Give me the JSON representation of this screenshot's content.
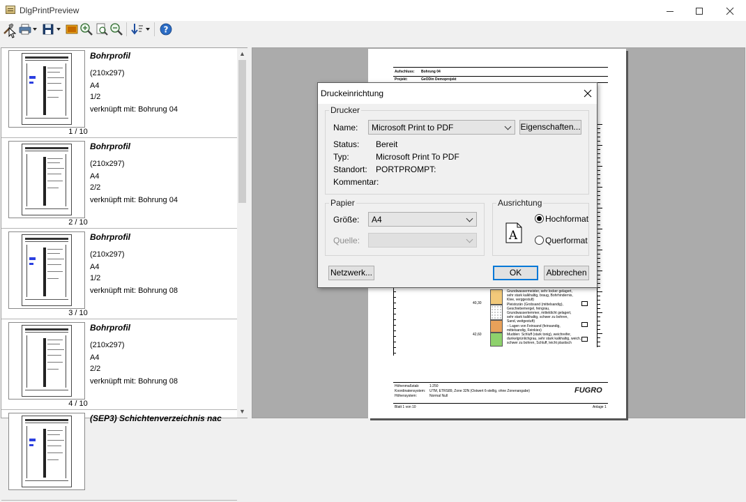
{
  "window": {
    "title": "DlgPrintPreview"
  },
  "toolbar": {
    "icons": [
      "tools-icon",
      "printer-icon",
      "save-icon",
      "image-icon",
      "zoom-in-icon",
      "zoom-page-icon",
      "zoom-out-icon",
      "sort-icon",
      "help-icon"
    ]
  },
  "thumbnails": [
    {
      "name": "Bohrprofil",
      "size": "(210x297)",
      "format": "A4",
      "pages": "1/2",
      "linked": "verknüpft mit: Bohrung 04",
      "index": "1 / 10"
    },
    {
      "name": "Bohrprofil",
      "size": "(210x297)",
      "format": "A4",
      "pages": "2/2",
      "linked": "verknüpft mit: Bohrung 04",
      "index": "2 / 10"
    },
    {
      "name": "Bohrprofil",
      "size": "(210x297)",
      "format": "A4",
      "pages": "1/2",
      "linked": "verknüpft mit: Bohrung 08",
      "index": "3 / 10"
    },
    {
      "name": "Bohrprofil",
      "size": "(210x297)",
      "format": "A4",
      "pages": "2/2",
      "linked": "verknüpft mit: Bohrung 08",
      "index": "4 / 10"
    },
    {
      "name": "(SEP3) Schichtenverzeichnis nac"
    }
  ],
  "preview": {
    "header": {
      "aufschluss_label": "Aufschluss:",
      "aufschluss_value": "Bohrung 04",
      "projekt_label": "Projekt:",
      "projekt_value": "GeODin Demoprojekt"
    },
    "depths": [
      "40,30",
      "42,60"
    ],
    "descriptions": [
      "Grundwassermeister, sehr locker gelagert,",
      "sehr stark kalkhaltig, braug, Bohrhindernis,",
      "Klee, verggestult)",
      "Pleistozän (Grobsand (mittelsandig),",
      "Geschiebemergel, feingrau,",
      "Grundwassertemmer, mitteldicht gelagert,",
      "sehr stark kalkhaltig, schwer zu bohren,",
      "Sand, weitgestuft)",
      "– Lagen von Feinsand (feinsandig,",
      "mittelsandig, Feinkies)",
      "Mudden: Schluff (stark tonig), weichreifer,",
      "dunkelgrünlichgrau, sehr stark kalkhaltig, weich,",
      "schwer zu bohren, Schluff, leicht plastisch"
    ],
    "footer_left": [
      "Höhenmaßstab:",
      "Koordinatensystem:",
      "Höhensystem:"
    ],
    "footer_vals": [
      "1:250",
      "UTM, ETRS89, Zone 32N (Ostwert 6-stellig, ohne Zonenangabe)",
      "Normal Null"
    ],
    "footer_page": "Blatt 1 von 10",
    "footer_anlage": "Anlage 1",
    "logo": "FUGRO"
  },
  "dialog": {
    "title": "Druckeinrichtung",
    "printer_group": "Drucker",
    "name_label": "Name:",
    "name_value": "Microsoft Print to PDF",
    "properties_button": "Eigenschaften...",
    "status_label": "Status:",
    "status_value": "Bereit",
    "type_label": "Typ:",
    "type_value": "Microsoft Print To PDF",
    "location_label": "Standort:",
    "location_value": "PORTPROMPT:",
    "comment_label": "Kommentar:",
    "paper_group": "Papier",
    "size_label": "Größe:",
    "size_value": "A4",
    "source_label": "Quelle:",
    "orientation_group": "Ausrichtung",
    "portrait_label": "Hochformat",
    "landscape_label": "Querformat",
    "network_button": "Netzwerk...",
    "ok_button": "OK",
    "cancel_button": "Abbrechen"
  }
}
